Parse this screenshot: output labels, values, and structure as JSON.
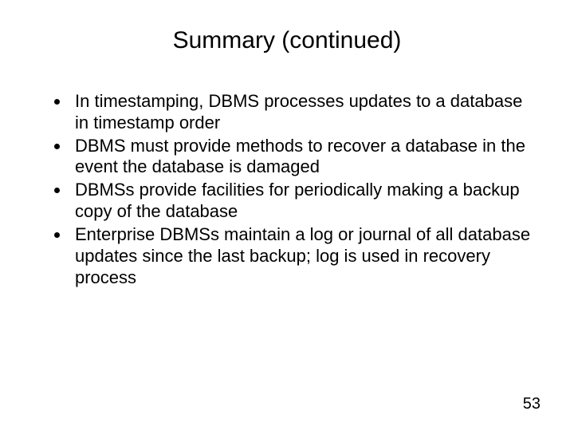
{
  "title": "Summary (continued)",
  "bullets": [
    "In timestamping, DBMS processes updates to a database in timestamp order",
    "DBMS must provide methods to recover a database in the event the database is damaged",
    "DBMSs provide facilities for periodically making a backup copy of the database",
    "Enterprise DBMSs maintain a log or journal of all database updates since the last backup; log is used in recovery process"
  ],
  "page_number": "53"
}
